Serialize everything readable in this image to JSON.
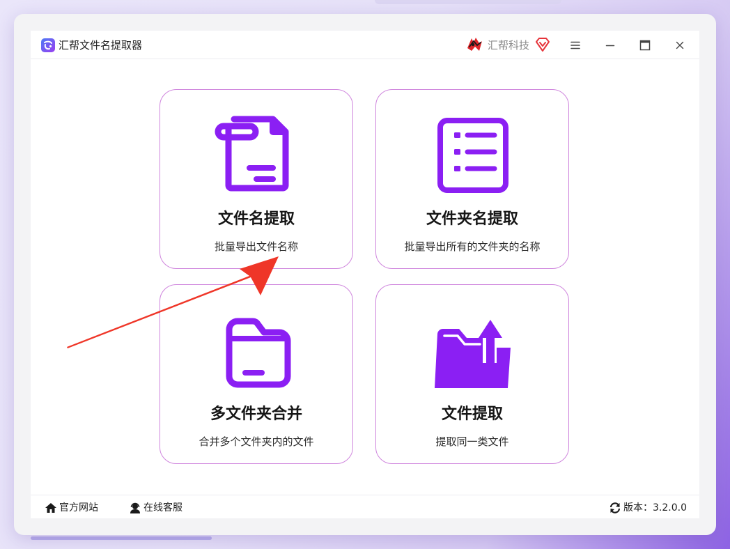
{
  "app": {
    "title": "汇帮文件名提取器",
    "brand": "汇帮科技"
  },
  "colors": {
    "accent": "#8b1ff3",
    "card_border": "#cf85dd",
    "annotation_arrow": "#ef3628"
  },
  "window_controls": [
    "menu-icon",
    "minimize-icon",
    "maximize-icon",
    "close-icon"
  ],
  "cards": [
    {
      "title": "文件名提取",
      "subtitle": "批量导出文件名称",
      "icon": "file-icon"
    },
    {
      "title": "文件夹名提取",
      "subtitle": "批量导出所有的文件夹的名称",
      "icon": "list-icon"
    },
    {
      "title": "多文件夹合并",
      "subtitle": "合并多个文件夹内的文件",
      "icon": "folder-icon"
    },
    {
      "title": "文件提取",
      "subtitle": "提取同一类文件",
      "icon": "folder-upload-icon"
    }
  ],
  "footer": {
    "website": "官方网站",
    "support": "在线客服",
    "version_label": "版本：",
    "version": "3.2.0.0"
  }
}
